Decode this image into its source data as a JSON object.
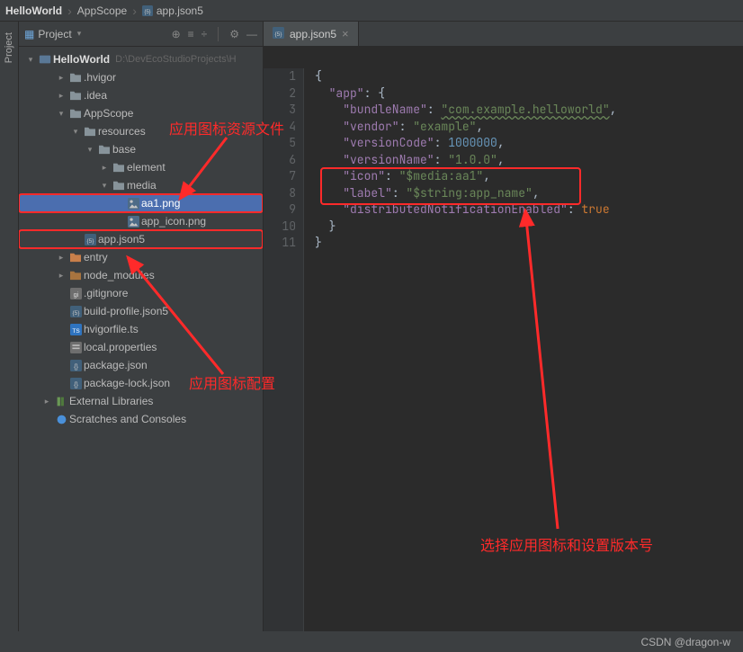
{
  "breadcrumb": {
    "root": "HelloWorld",
    "mid": "AppScope",
    "file": "app.json5"
  },
  "sideTab": {
    "label": "Project"
  },
  "sidebar": {
    "title": "Project",
    "project": {
      "name": "HelloWorld",
      "path": "D:\\DevEcoStudioProjects\\H"
    },
    "tree": [
      {
        "depth": 1,
        "twisty": ">",
        "icon": "folder",
        "label": ".hvigor"
      },
      {
        "depth": 1,
        "twisty": ">",
        "icon": "folder",
        "label": ".idea"
      },
      {
        "depth": 1,
        "twisty": "v",
        "icon": "folder",
        "label": "AppScope"
      },
      {
        "depth": 2,
        "twisty": "v",
        "icon": "folder",
        "label": "resources"
      },
      {
        "depth": 3,
        "twisty": "v",
        "icon": "folder",
        "label": "base"
      },
      {
        "depth": 4,
        "twisty": ">",
        "icon": "folder",
        "label": "element"
      },
      {
        "depth": 4,
        "twisty": "v",
        "icon": "folder",
        "label": "media"
      },
      {
        "depth": 5,
        "twisty": " ",
        "icon": "image",
        "label": "aa1.png",
        "selected": true,
        "redbox": true
      },
      {
        "depth": 5,
        "twisty": " ",
        "icon": "image",
        "label": "app_icon.png"
      },
      {
        "depth": 2,
        "twisty": " ",
        "icon": "json5",
        "label": "app.json5",
        "redbox": true
      },
      {
        "depth": 1,
        "twisty": ">",
        "icon": "folder-src",
        "label": "entry"
      },
      {
        "depth": 1,
        "twisty": ">",
        "icon": "folder-lib",
        "label": "node_modules"
      },
      {
        "depth": 1,
        "twisty": " ",
        "icon": "gitignore",
        "label": ".gitignore"
      },
      {
        "depth": 1,
        "twisty": " ",
        "icon": "json5",
        "label": "build-profile.json5"
      },
      {
        "depth": 1,
        "twisty": " ",
        "icon": "ts",
        "label": "hvigorfile.ts"
      },
      {
        "depth": 1,
        "twisty": " ",
        "icon": "props",
        "label": "local.properties"
      },
      {
        "depth": 1,
        "twisty": " ",
        "icon": "json",
        "label": "package.json"
      },
      {
        "depth": 1,
        "twisty": " ",
        "icon": "json",
        "label": "package-lock.json"
      },
      {
        "depth": 0,
        "twisty": ">",
        "icon": "libs",
        "label": "External Libraries"
      },
      {
        "depth": 0,
        "twisty": " ",
        "icon": "scratch",
        "label": "Scratches and Consoles"
      }
    ]
  },
  "tab": {
    "label": "app.json5"
  },
  "code": {
    "lines": [
      "1",
      "2",
      "3",
      "4",
      "5",
      "6",
      "7",
      "8",
      "9",
      "10",
      "11"
    ],
    "content": {
      "app": "\"app\"",
      "bundleName_k": "\"bundleName\"",
      "bundleName_v": "\"com.example.helloworld\"",
      "vendor_k": "\"vendor\"",
      "vendor_v": "\"example\"",
      "versionCode_k": "\"versionCode\"",
      "versionCode_v": "1000000",
      "versionName_k": "\"versionName\"",
      "versionName_v": "\"1.0.0\"",
      "icon_k": "\"icon\"",
      "icon_v": "\"$media:aa1\"",
      "label_k": "\"label\"",
      "label_v": "\"$string:app_name\"",
      "dist_k": "\"distributedNotificationEnabled\"",
      "dist_v": "true"
    }
  },
  "annotations": {
    "resource": "应用图标资源文件",
    "config": "应用图标配置",
    "choose": "选择应用图标和设置版本号"
  },
  "watermark": "CSDN @dragon-w"
}
